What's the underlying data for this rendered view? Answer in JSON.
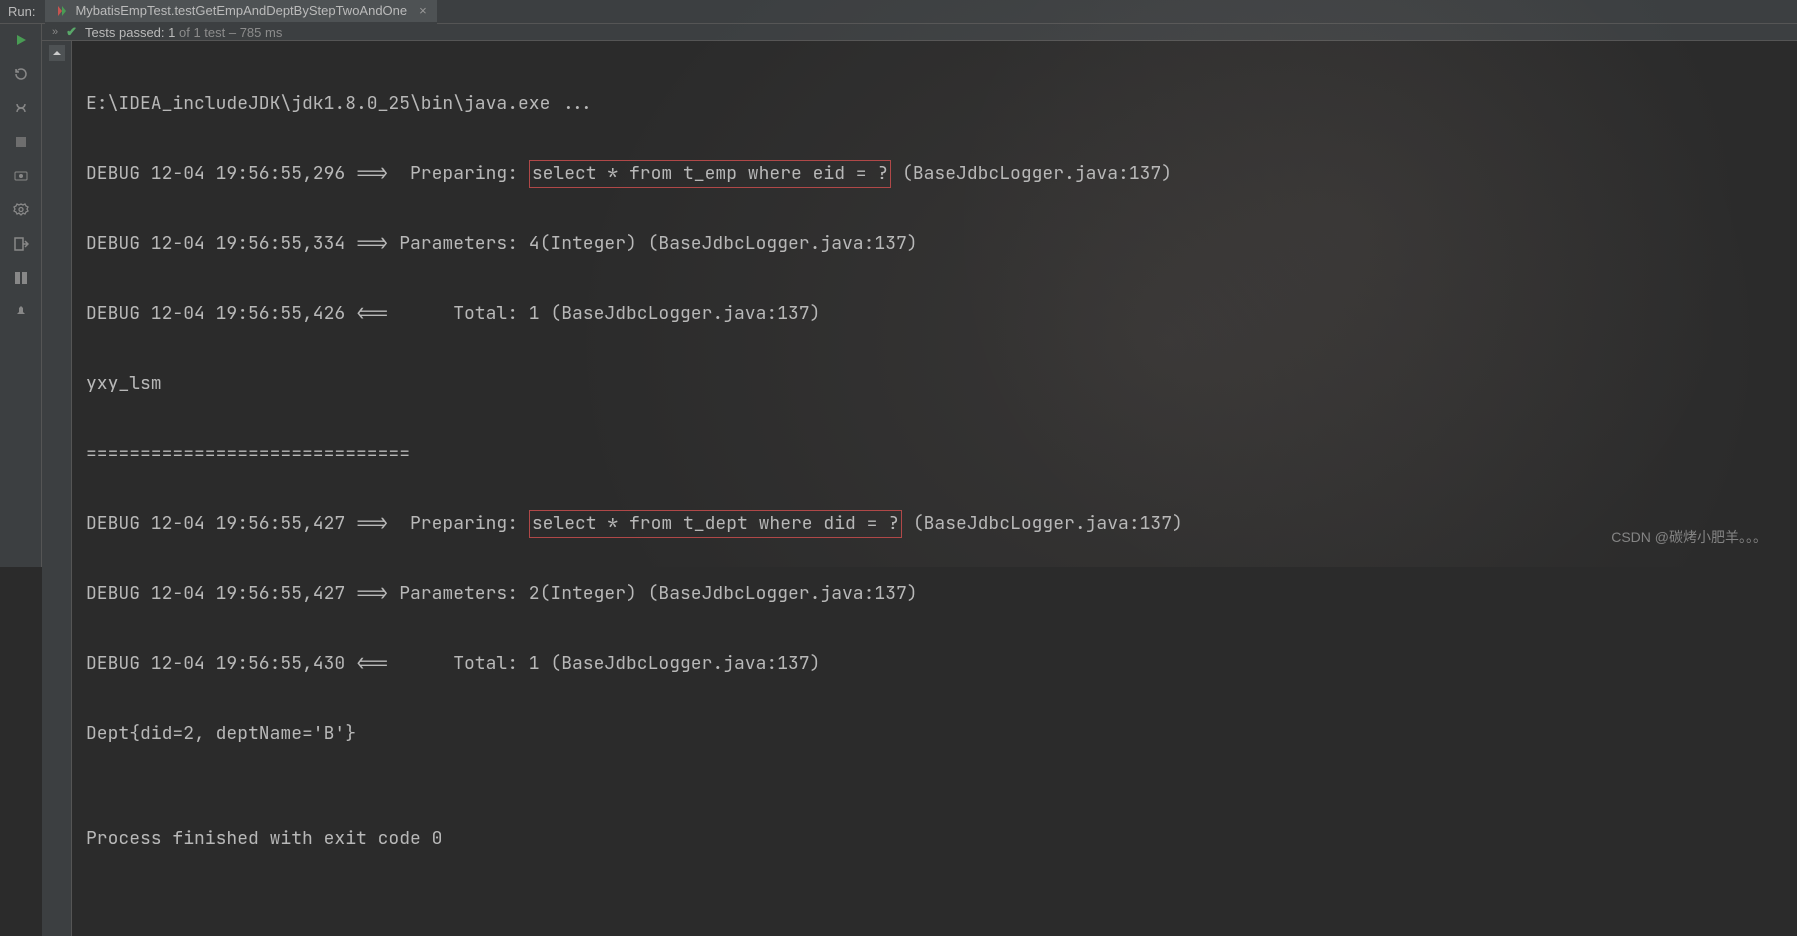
{
  "topbar": {
    "run_label": "Run:",
    "tab_title": "MybatisEmpTest.testGetEmpAndDeptByStepTwoAndOne",
    "tab_close": "×"
  },
  "status": {
    "chevrons": "»",
    "check": "✔",
    "passed_label": "Tests passed:",
    "passed_count": "1",
    "of_text": " of 1 test – 785 ms"
  },
  "console": {
    "line0": "E:\\IDEA_includeJDK\\jdk1.8.0_25\\bin\\java.exe ...",
    "line1_a": "DEBUG 12-04 19:56:55,296 ==>  Preparing: ",
    "line1_hl": "select * from t_emp where eid = ?",
    "line1_b": " (BaseJdbcLogger.java:137)",
    "line2": "DEBUG 12-04 19:56:55,334 ==> Parameters: 4(Integer) (BaseJdbcLogger.java:137)",
    "line3": "DEBUG 12-04 19:56:55,426 <==      Total: 1 (BaseJdbcLogger.java:137)",
    "line4": "yxy_lsm",
    "line5": "==============================",
    "line6_a": "DEBUG 12-04 19:56:55,427 ==>  Preparing: ",
    "line6_hl": "select * from t_dept where did = ?",
    "line6_b": " (BaseJdbcLogger.java:137)",
    "line7": "DEBUG 12-04 19:56:55,427 ==> Parameters: 2(Integer) (BaseJdbcLogger.java:137)",
    "line8": "DEBUG 12-04 19:56:55,430 <==      Total: 1 (BaseJdbcLogger.java:137)",
    "line9": "Dept{did=2, deptName='B'}",
    "line10": "",
    "line11": "Process finished with exit code 0"
  },
  "watermark": "CSDN @碳烤小肥羊。。。"
}
